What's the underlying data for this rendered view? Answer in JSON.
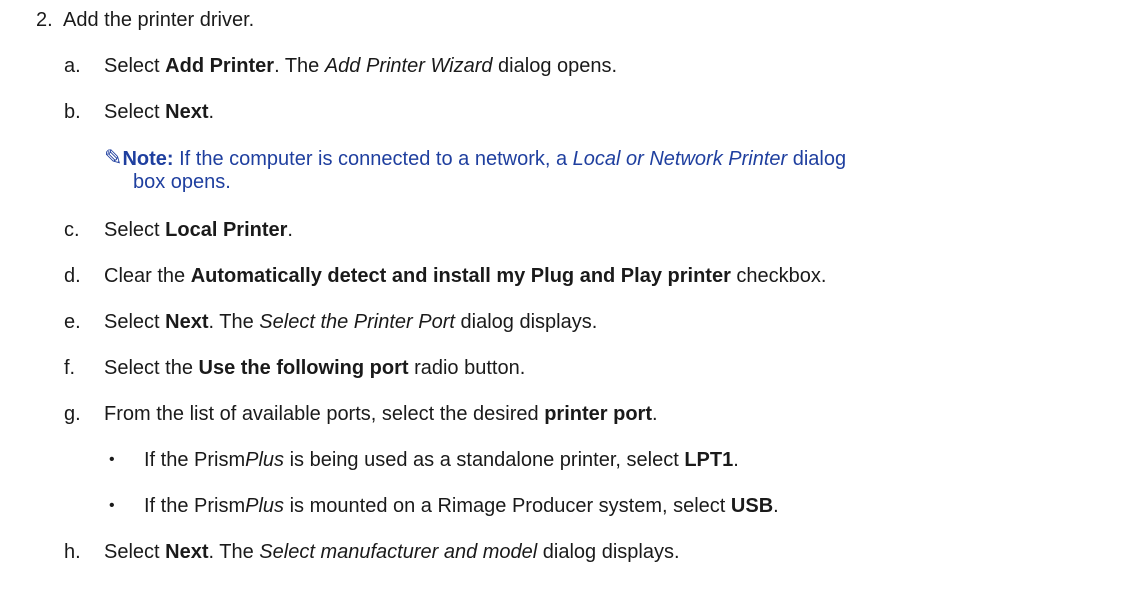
{
  "step2": {
    "number": "2.",
    "text": "Add the printer driver."
  },
  "substeps": [
    {
      "letter": "a.",
      "t1": "Select ",
      "b1": "Add Printer",
      "t2": ". The ",
      "i1": "Add Printer Wizard",
      "t3": " dialog opens."
    },
    {
      "letter": "b.",
      "t1": "Select ",
      "b1": "Next",
      "t2": "."
    },
    {
      "letter": "c.",
      "t1": "Select ",
      "b1": "Local Printer",
      "t2": "."
    },
    {
      "letter": "d.",
      "t1": "Clear the ",
      "b1": "Automatically detect and install my Plug and Play printer",
      "t2": " checkbox."
    },
    {
      "letter": "e.",
      "t1": "Select ",
      "b1": "Next",
      "t2": ". The ",
      "i1": "Select the Printer Port",
      "t3": " dialog displays."
    },
    {
      "letter": "f.",
      "t1": "Select the ",
      "b1": "Use the following port",
      "t2": " radio button."
    },
    {
      "letter": "g.",
      "t1": "From the list of available ports, select the desired ",
      "b1": "printer port",
      "t2": "."
    },
    {
      "letter": "h.",
      "t1": "Select ",
      "b1": "Next",
      "t2": ". The ",
      "i1": "Select manufacturer and model",
      "t3": " dialog displays."
    }
  ],
  "note": {
    "icon": "✎",
    "label": "Note:",
    "t1": " If the computer is connected to a network, a ",
    "i1": "Local or Network Printer",
    "t2": " dialog",
    "line2": "box opens."
  },
  "bullets": [
    {
      "symbol": "•",
      "t1": "If the Prism",
      "i1": "Plus",
      "t2": " is being used as a standalone printer, select ",
      "b1": "LPT1",
      "t3": "."
    },
    {
      "symbol": "•",
      "t1": "If the Prism",
      "i1": "Plus",
      "t2": " is mounted on a Rimage Producer system, select ",
      "b1": "USB",
      "t3": "."
    }
  ]
}
